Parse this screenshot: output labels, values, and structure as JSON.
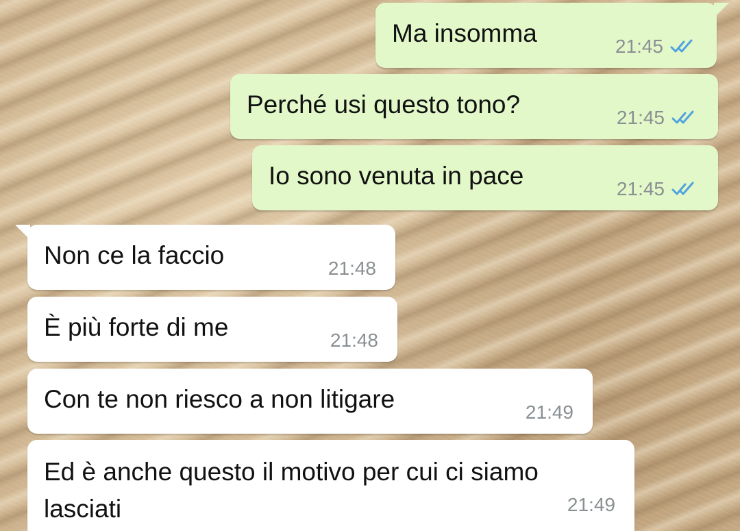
{
  "messages": [
    {
      "text": "Ma insomma",
      "time": "21:45",
      "direction": "outgoing",
      "status": "read"
    },
    {
      "text": "Perché usi questo tono?",
      "time": "21:45",
      "direction": "outgoing",
      "status": "read"
    },
    {
      "text": "Io sono venuta in pace",
      "time": "21:45",
      "direction": "outgoing",
      "status": "read"
    },
    {
      "text": "Non ce la faccio",
      "time": "21:48",
      "direction": "incoming"
    },
    {
      "text": "È più forte di me",
      "time": "21:48",
      "direction": "incoming"
    },
    {
      "text": "Con te non riesco a non litigare",
      "time": "21:49",
      "direction": "incoming"
    },
    {
      "text": "Ed è anche questo il motivo per cui ci siamo lasciati",
      "time": "21:49",
      "direction": "incoming"
    }
  ],
  "colors": {
    "outgoing_bubble": "#e2f8c9",
    "incoming_bubble": "#ffffff",
    "read_ticks": "#4fa3e0",
    "timestamp": "#8a8f92"
  },
  "icons": {
    "read_receipt": "double-check-icon"
  }
}
